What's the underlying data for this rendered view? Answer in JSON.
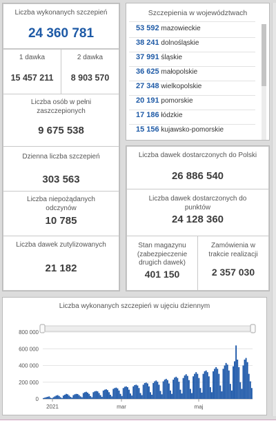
{
  "total": {
    "label": "Liczba wykonanych szczepień",
    "value": "24 360 781"
  },
  "dose1": {
    "label": "1 dawka",
    "value": "15 457 211"
  },
  "dose2": {
    "label": "2 dawka",
    "value": "8 903 570"
  },
  "full": {
    "label": "Liczba osób w pełni zaszczepionych",
    "value": "9 675 538"
  },
  "daily": {
    "label": "Dzienna liczba szczepień",
    "value": "303 563"
  },
  "adverse": {
    "label": "Liczba niepożądanych odczynów",
    "value": "10 785"
  },
  "utilized": {
    "label": "Liczba dawek zutylizowanych",
    "value": "21 182"
  },
  "regions": {
    "title": "Szczepienia w województwach",
    "items": [
      {
        "num": "53 592",
        "name": "mazowieckie"
      },
      {
        "num": "38 241",
        "name": "dolnośląskie"
      },
      {
        "num": "37 991",
        "name": "śląskie"
      },
      {
        "num": "36 625",
        "name": "małopolskie"
      },
      {
        "num": "27 348",
        "name": "wielkopolskie"
      },
      {
        "num": "20 191",
        "name": "pomorskie"
      },
      {
        "num": "17 186",
        "name": "łódzkie"
      },
      {
        "num": "15 156",
        "name": "kujawsko-pomorskie"
      }
    ]
  },
  "delivered_pl": {
    "label": "Liczba dawek dostarczonych do Polski",
    "value": "26 886 540"
  },
  "delivered_points": {
    "label": "Liczba dawek dostarczonych do punktów",
    "value": "24 128 360"
  },
  "stock": {
    "label": "Stan magazynu (zabezpieczenie drugich dawek)",
    "value": "401 150"
  },
  "orders": {
    "label": "Zamówienia w trakcie realizacji",
    "value": "2 357 030"
  },
  "colors": {
    "accent": "#1e5aa6",
    "bar": "#1a56a8",
    "panel_bg": "#dcdcdc"
  },
  "chart_data": {
    "type": "bar",
    "title": "Liczba wykonanych szczepień w ujęciu dziennym",
    "ylim": [
      0,
      800000
    ],
    "y_ticks": [
      "800 000",
      "600 000",
      "400 000",
      "200 000",
      "0"
    ],
    "x_ticks": [
      "2021",
      "mar",
      "maj"
    ],
    "series": [
      {
        "values": [
          10000,
          15000,
          20000,
          25000,
          30000,
          15000,
          8000,
          20000,
          30000,
          40000,
          45000,
          35000,
          20000,
          10000,
          40000,
          50000,
          60000,
          55000,
          40000,
          25000,
          15000,
          45000,
          55000,
          60000,
          58000,
          45000,
          30000,
          20000,
          70000,
          80000,
          85000,
          75000,
          60000,
          35000,
          20000,
          80000,
          90000,
          95000,
          90000,
          70000,
          45000,
          25000,
          100000,
          110000,
          115000,
          105000,
          80000,
          50000,
          30000,
          120000,
          130000,
          135000,
          125000,
          100000,
          60000,
          35000,
          130000,
          145000,
          150000,
          140000,
          110000,
          65000,
          40000,
          150000,
          165000,
          170000,
          160000,
          130000,
          70000,
          45000,
          170000,
          190000,
          195000,
          185000,
          150000,
          80000,
          50000,
          190000,
          210000,
          220000,
          205000,
          170000,
          95000,
          55000,
          210000,
          230000,
          240000,
          225000,
          185000,
          100000,
          60000,
          230000,
          255000,
          265000,
          250000,
          205000,
          110000,
          65000,
          250000,
          280000,
          295000,
          275000,
          225000,
          120000,
          70000,
          270000,
          300000,
          320000,
          300000,
          250000,
          130000,
          75000,
          300000,
          330000,
          340000,
          320000,
          270000,
          140000,
          80000,
          330000,
          360000,
          380000,
          360000,
          300000,
          160000,
          90000,
          360000,
          400000,
          430000,
          410000,
          340000,
          180000,
          100000,
          390000,
          450000,
          640000,
          470000,
          380000,
          200000,
          120000,
          400000,
          470000,
          490000,
          440000,
          300000,
          210000,
          130000
        ]
      }
    ]
  }
}
